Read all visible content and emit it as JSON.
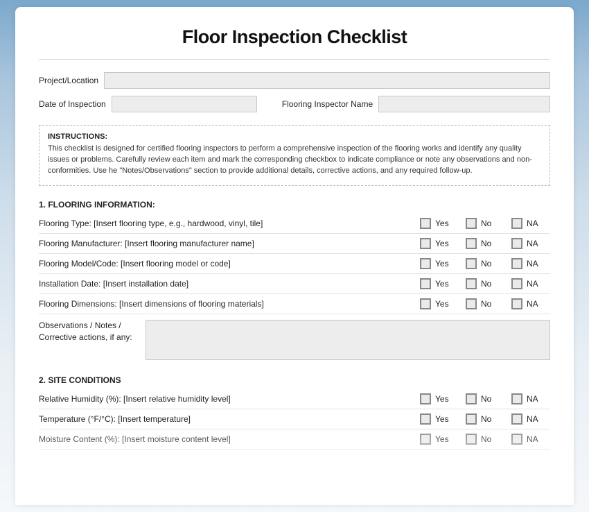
{
  "title": "Floor Inspection Checklist",
  "header": {
    "project_label": "Project/Location",
    "date_label": "Date of Inspection",
    "inspector_label": "Flooring Inspector Name"
  },
  "instructions": {
    "title": "INSTRUCTIONS:",
    "body": "This checklist is designed for certified flooring inspectors to perform a comprehensive inspection of the flooring works and identify any quality issues or problems. Carefully review each item and mark the corresponding checkbox to indicate compliance or note any observations and non-conformities. Use he \"Notes/Observations\" section to provide additional details, corrective actions, and any required follow-up."
  },
  "options": {
    "yes": "Yes",
    "no": "No",
    "na": "NA"
  },
  "section1": {
    "title": "1. FLOORING INFORMATION:",
    "items": [
      "Flooring Type: [Insert flooring type, e.g., hardwood, vinyl, tile]",
      "Flooring Manufacturer: [Insert flooring manufacturer name]",
      "Flooring Model/Code: [Insert flooring model or code]",
      "Installation Date: [Insert installation date]",
      "Flooring Dimensions: [Insert dimensions of flooring materials]"
    ],
    "notes_label": "Observations / Notes / Corrective actions, if any:"
  },
  "section2": {
    "title": "2. SITE CONDITIONS",
    "items": [
      "Relative Humidity (%): [Insert relative humidity level]",
      "Temperature (°F/°C): [Insert temperature]",
      "Moisture Content (%): [Insert moisture content level]"
    ]
  }
}
